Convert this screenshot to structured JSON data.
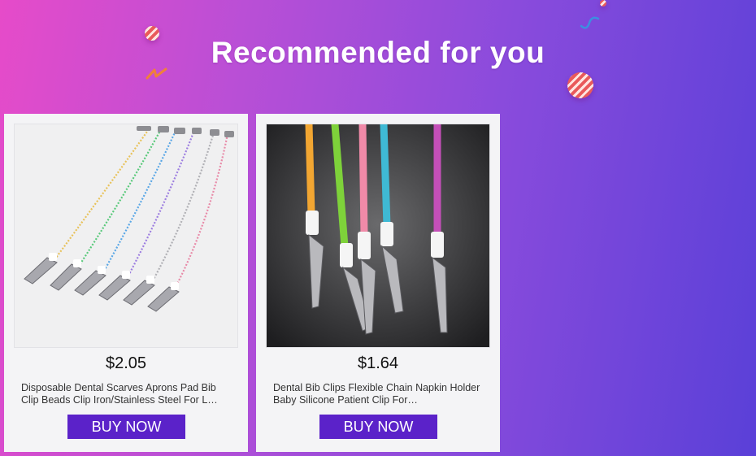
{
  "banner": {
    "title": "Recommended for you",
    "gradient_start": "#e64bc9",
    "gradient_end": "#5a40d8"
  },
  "products": [
    {
      "price": "$2.05",
      "title": "Disposable Dental Scarves Aprons Pad Bib Clip Beads Clip Iron/Stainless Steel For L…",
      "buy_label": "BUY NOW",
      "image": "dental-bib-bead-chain-clips-photo"
    },
    {
      "price": "$1.64",
      "title": "Dental Bib Clips Flexible Chain Napkin Holder Baby Silicone Patient Clip For…",
      "buy_label": "BUY NOW",
      "image": "silicone-bib-clips-photo"
    }
  ],
  "colors": {
    "button": "#5b22c9",
    "card": "#f4f4f6"
  }
}
